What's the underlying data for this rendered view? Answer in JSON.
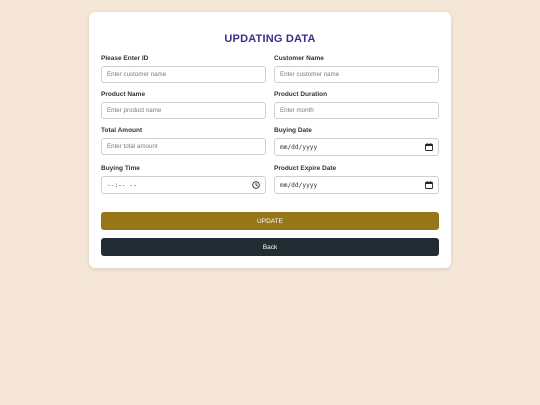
{
  "form": {
    "title": "UPDATING DATA",
    "fields": [
      {
        "label": "Please Enter ID",
        "placeholder": "Enter customer name"
      },
      {
        "label": "Customer Name",
        "placeholder": "Enter customer name"
      },
      {
        "label": "Product Name",
        "placeholder": "Enter product name"
      },
      {
        "label": "Product Duration",
        "placeholder": "Enter month"
      },
      {
        "label": "Total Amount",
        "placeholder": "Enter total amount"
      },
      {
        "label": "Buying Date",
        "placeholder": "mm/dd/yyyy"
      },
      {
        "label": "Buying Time",
        "placeholder": "--:-- --"
      },
      {
        "label": "Product Expire Date",
        "placeholder": "mm/dd/yyyy"
      }
    ],
    "update_label": "UPDATE",
    "back_label": "Back"
  },
  "colors": {
    "page_bg": "#f5e6d8",
    "title": "#3b2f8a",
    "update_button": "#977619",
    "back_button": "#212d33"
  },
  "icons": {
    "date": "calendar-icon",
    "time": "clock-icon"
  }
}
